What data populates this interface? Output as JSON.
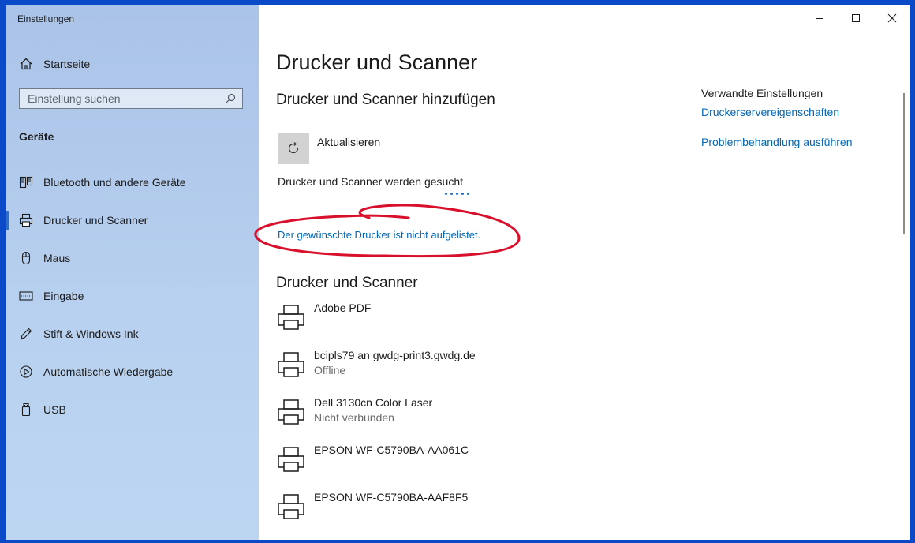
{
  "window": {
    "title": "Einstellungen"
  },
  "sidebar": {
    "home": {
      "label": "Startseite",
      "icon": "home-icon"
    },
    "search": {
      "placeholder": "Einstellung suchen",
      "icon": "search-icon"
    },
    "section_label": "Geräte",
    "items": [
      {
        "label": "Bluetooth und andere Geräte",
        "icon": "bluetooth-devices-icon",
        "active": false
      },
      {
        "label": "Drucker und Scanner",
        "icon": "printer-icon",
        "active": true
      },
      {
        "label": "Maus",
        "icon": "mouse-icon",
        "active": false
      },
      {
        "label": "Eingabe",
        "icon": "keyboard-icon",
        "active": false
      },
      {
        "label": "Stift & Windows Ink",
        "icon": "pen-icon",
        "active": false
      },
      {
        "label": "Automatische Wiedergabe",
        "icon": "autoplay-icon",
        "active": false
      },
      {
        "label": "USB",
        "icon": "usb-icon",
        "active": false
      }
    ]
  },
  "main": {
    "title": "Drucker und Scanner",
    "add_section": {
      "heading": "Drucker und Scanner hinzufügen",
      "refresh_label": "Aktualisieren",
      "status": "Drucker und Scanner werden gesucht",
      "not_listed_link": "Der gewünschte Drucker ist nicht aufgelistet."
    },
    "list_section": {
      "heading": "Drucker und Scanner",
      "printers": [
        {
          "name": "Adobe PDF",
          "status": ""
        },
        {
          "name": "bcipls79 an gwdg-print3.gwdg.de",
          "status": "Offline"
        },
        {
          "name": "Dell 3130cn Color Laser",
          "status": "Nicht verbunden"
        },
        {
          "name": "EPSON WF-C5790BA-AA061C",
          "status": ""
        },
        {
          "name": "EPSON WF-C5790BA-AAF8F5",
          "status": ""
        }
      ]
    }
  },
  "related": {
    "title": "Verwandte Einstellungen",
    "links": [
      "Druckerservereigenschaften",
      "Problembehandlung ausführen"
    ]
  },
  "colors": {
    "accent": "#0066b4",
    "annotation": "#d8102c",
    "desktop": "#0a49c7"
  }
}
